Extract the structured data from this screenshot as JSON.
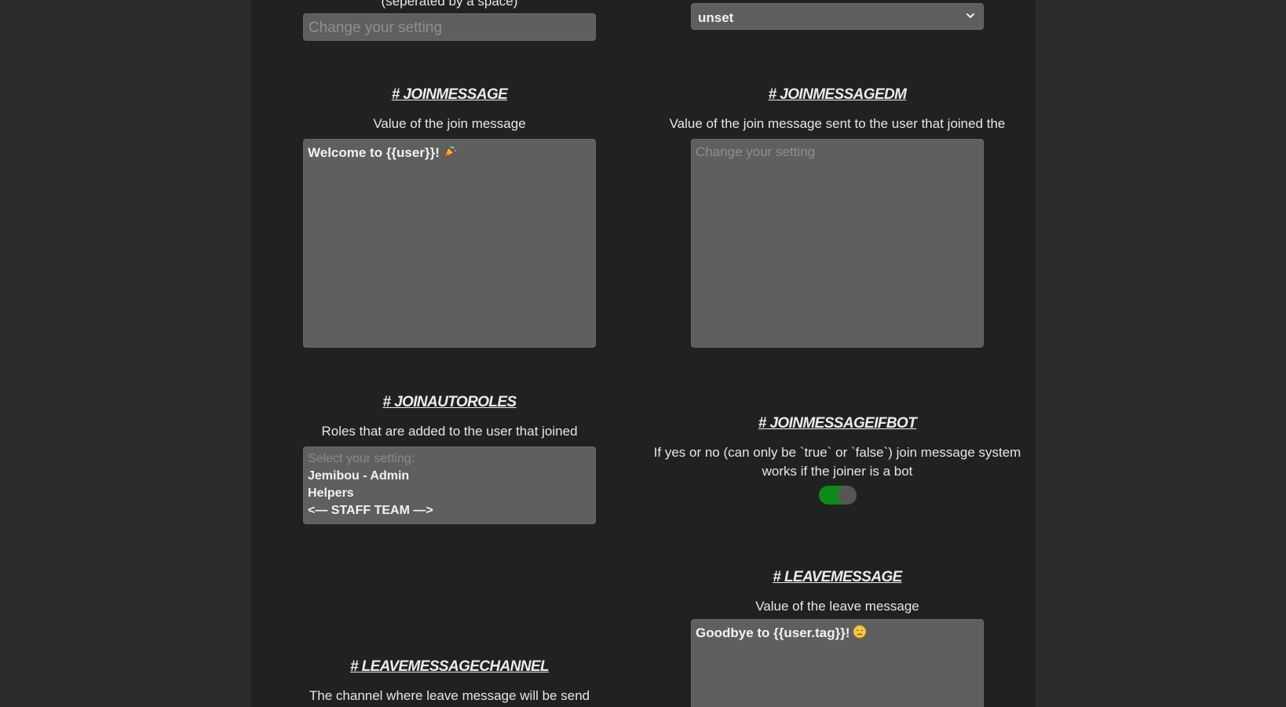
{
  "top_fields": {
    "left_desc_fragment": "(seperated by a space)",
    "left_input_placeholder": "Change your setting",
    "right_dropdown_value": "unset"
  },
  "joinmessage": {
    "title": "# JOINMESSAGE",
    "description": "Value of the join message",
    "value": "Welcome to {{user}}!",
    "emoji_icon": "party-popper-icon"
  },
  "joinmessagedm": {
    "title": "# JOINMESSAGEDM",
    "description": "Value of the join message sent to the user that joined the server",
    "placeholder": "Change your setting"
  },
  "joinautoroles": {
    "title": "# JOINAUTOROLES",
    "description": "Roles that are added to the user that joined",
    "placeholder": "Select your setting:",
    "options": [
      "Jemibou - Admin",
      "Helpers",
      "<— STAFF TEAM —>"
    ]
  },
  "joinmessageifbot": {
    "title": "# JOINMESSAGEIFBOT",
    "description_line1": "If yes or no (can only be `true` or `false`) join message system",
    "description_line2": "works if the joiner is a bot",
    "enabled": true,
    "toggle_on_color": "#0e8a1a"
  },
  "leavemessage": {
    "title": "# LEAVEMESSAGE",
    "description": "Value of the leave message",
    "value": "Goodbye to {{user.tag}}!",
    "emoji_icon": "disappointed-face-icon"
  },
  "leavemessagechannel": {
    "title": "# LEAVEMESSAGECHANNEL",
    "description": "The channel where leave message will be send"
  },
  "colors": {
    "page_background": "#2b2b2b",
    "panel_background": "#212121",
    "field_background": "#5f5f5f",
    "placeholder_text": "#8f8f8f"
  }
}
